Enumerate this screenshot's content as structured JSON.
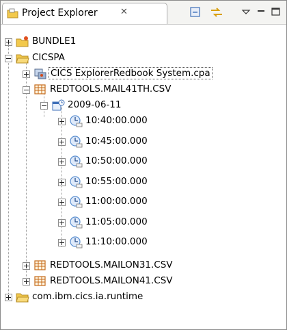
{
  "view": {
    "title": "Project Explorer",
    "close_glyph": "✕"
  },
  "toolbar": {
    "collapse_all_icon": "collapse-all-icon",
    "link_editor_icon": "link-with-editor-icon",
    "view_menu_icon": "view-menu-icon",
    "minimize_icon": "minimize-icon",
    "maximize_icon": "maximize-icon"
  },
  "tree": {
    "bundle1": "BUNDLE1",
    "cicspa": "CICSPA",
    "cpa_file": "CICS ExplorerRedbook System.cpa",
    "mail41th": "REDTOOLS.MAIL41TH.CSV",
    "date": "2009-06-11",
    "times": [
      "10:40:00.000",
      "10:45:00.000",
      "10:50:00.000",
      "10:55:00.000",
      "11:00:00.000",
      "11:05:00.000",
      "11:10:00.000"
    ],
    "mailon31": "REDTOOLS.MAILON31.CSV",
    "mailon41": "REDTOOLS.MAILON41.CSV",
    "runtime": "com.ibm.cics.ia.runtime"
  },
  "colors": {
    "folder": "#f2c94c",
    "table_grid": "#c46a1a",
    "clock": "#5a8fd0"
  }
}
